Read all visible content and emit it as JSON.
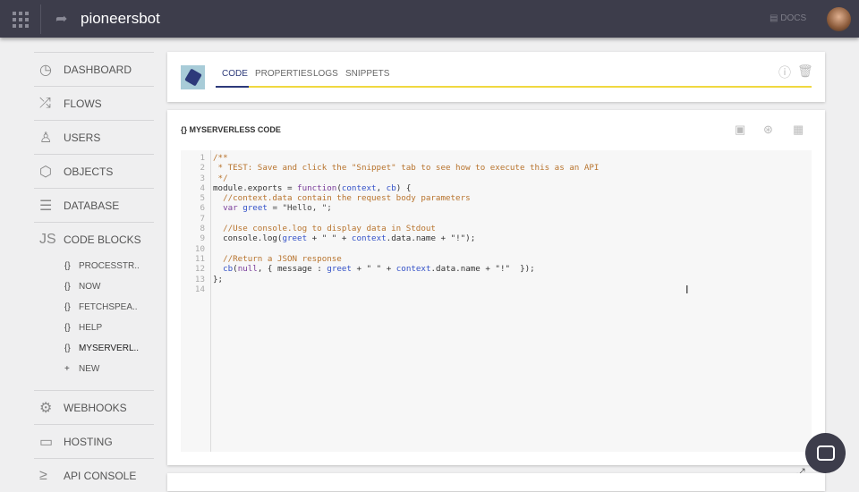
{
  "header": {
    "title": "pioneersbot",
    "docs": "DOCS"
  },
  "sidebar": {
    "items": [
      {
        "label": "DASHBOARD",
        "icon": "◷"
      },
      {
        "label": "FLOWS",
        "icon": "⤮"
      },
      {
        "label": "USERS",
        "icon": "♙"
      },
      {
        "label": "OBJECTS",
        "icon": "⬡"
      },
      {
        "label": "DATABASE",
        "icon": "☰"
      },
      {
        "label": "CODE BLOCKS",
        "icon": "JS"
      }
    ],
    "subitems": [
      {
        "label": "PROCESSTR..",
        "icon": "{}"
      },
      {
        "label": "NOW",
        "icon": "{}"
      },
      {
        "label": "FETCHSPEA..",
        "icon": "{}"
      },
      {
        "label": "HELP",
        "icon": "{}"
      },
      {
        "label": "MYSERVERL..",
        "icon": "{}"
      },
      {
        "label": "NEW",
        "icon": "+"
      }
    ],
    "bottom_items": [
      {
        "label": "WEBHOOKS",
        "icon": "⚙"
      },
      {
        "label": "HOSTING",
        "icon": "▭"
      },
      {
        "label": "API CONSOLE",
        "icon": "≥"
      }
    ]
  },
  "tabs": [
    "CODE",
    "PROPERTIES",
    "LOGS",
    "SNIPPETS"
  ],
  "code_panel": {
    "title": "{} MYSERVERLESS CODE"
  },
  "code": [
    [
      [
        "/**",
        "cm"
      ]
    ],
    [
      [
        " * TEST: Save and click the \"Snippet\" tab to see how to execute this as an API",
        "cm"
      ]
    ],
    [
      [
        " */",
        "cm"
      ]
    ],
    [
      [
        "module.exports = ",
        "def"
      ],
      [
        "function",
        "kw"
      ],
      [
        "(",
        "def"
      ],
      [
        "context",
        "var"
      ],
      [
        ", ",
        "def"
      ],
      [
        "cb",
        "var"
      ],
      [
        ") {",
        "def"
      ]
    ],
    [
      [
        "  //context.data contain the request body parameters",
        "cm"
      ]
    ],
    [
      [
        "  ",
        "def"
      ],
      [
        "var",
        "kw"
      ],
      [
        " ",
        "def"
      ],
      [
        "greet",
        "var"
      ],
      [
        " = \"Hello, \";",
        "str"
      ]
    ],
    [
      [
        "",
        "def"
      ]
    ],
    [
      [
        "  //Use console.log to display data in Stdout",
        "cm"
      ]
    ],
    [
      [
        "  console.log(",
        "def"
      ],
      [
        "greet",
        "var"
      ],
      [
        " + \" \" + ",
        "def"
      ],
      [
        "context",
        "var"
      ],
      [
        ".data.name + \"!\");",
        "def"
      ]
    ],
    [
      [
        "",
        "def"
      ]
    ],
    [
      [
        "  //Return a JSON response",
        "cm"
      ]
    ],
    [
      [
        "  ",
        "def"
      ],
      [
        "cb",
        "var"
      ],
      [
        "(",
        "def"
      ],
      [
        "null",
        "kw"
      ],
      [
        ", { message : ",
        "def"
      ],
      [
        "greet",
        "var"
      ],
      [
        " + \" \" + ",
        "def"
      ],
      [
        "context",
        "var"
      ],
      [
        ".data.name + \"!\"  });",
        "def"
      ]
    ],
    [
      [
        "};",
        "def"
      ]
    ],
    [
      [
        "",
        "def"
      ]
    ]
  ]
}
